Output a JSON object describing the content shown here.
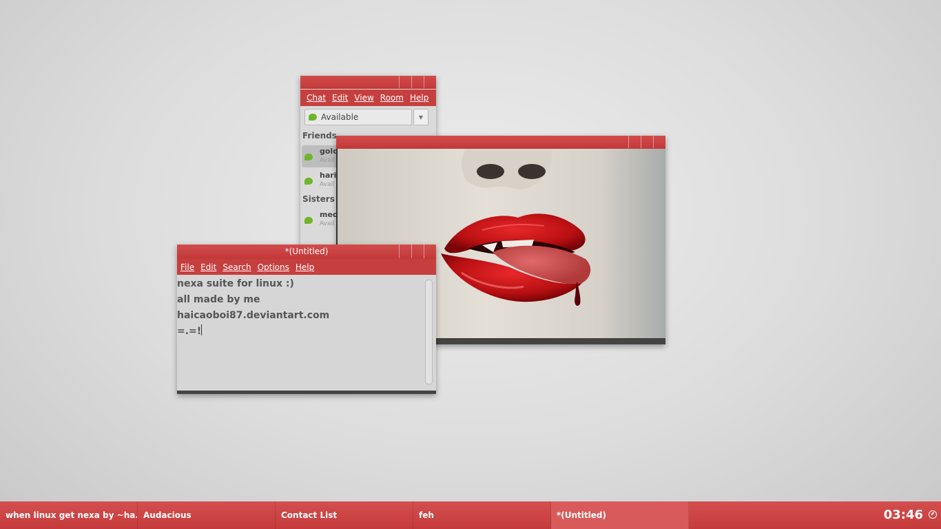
{
  "pidgin": {
    "menu": [
      "Chat",
      "Edit",
      "View",
      "Room",
      "Help"
    ],
    "status": "Available",
    "groups": [
      {
        "name": "Friends",
        "buddies": [
          {
            "name": "gold",
            "status": "Avail"
          },
          {
            "name": "hariv",
            "status": "Avail"
          }
        ]
      },
      {
        "name": "Sisters",
        "buddies": [
          {
            "name": "meo",
            "status": "Avail"
          }
        ]
      }
    ]
  },
  "editor": {
    "title": "*(Untitled)",
    "menu": [
      "File",
      "Edit",
      "Search",
      "Options",
      "Help"
    ],
    "lines": [
      "nexa suite for linux :)",
      "all made by me",
      "haicaoboi87.deviantart.com",
      "=.=!"
    ]
  },
  "taskbar": {
    "tasks": [
      "when linux get nexa by ~ha...",
      "Audacious",
      "Contact List",
      "feh",
      "*(Untitled)"
    ],
    "clock": "03:46"
  },
  "colors": {
    "accent": "#c94343",
    "background": "#dcdcdc"
  }
}
